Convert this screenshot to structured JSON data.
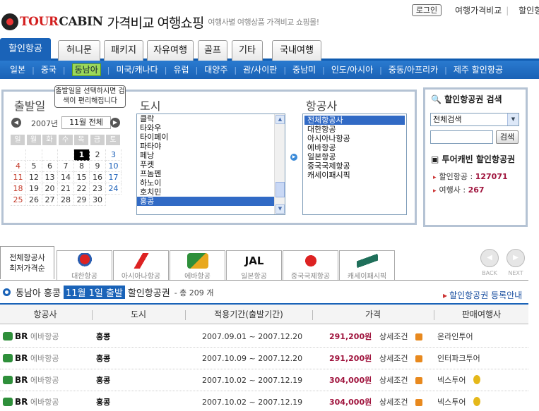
{
  "header": {
    "logo_tour": "TOUR",
    "logo_cabin": "CABIN",
    "logo_main": "가격비교 여행쇼핑",
    "logo_sub": "여행사별 여행상품 가격비교 쇼핑몰!",
    "login": "로그인",
    "top_links": [
      "여행가격비교",
      "할인항공"
    ]
  },
  "tabs": [
    {
      "label": "할인항공",
      "active": true
    },
    {
      "label": "허니문"
    },
    {
      "label": "패키지"
    },
    {
      "label": "자유여행"
    },
    {
      "label": "골프"
    },
    {
      "label": "기타"
    },
    {
      "label": "국내여행"
    }
  ],
  "subnav": [
    "일본",
    "중국",
    "동남아",
    "미국/캐나다",
    "유럽",
    "대양주",
    "괌/사이판",
    "중남미",
    "인도/아시아",
    "중동/아프리카",
    "제주 할인항공"
  ],
  "subnav_selected": "동남아",
  "search": {
    "departure_label": "출발일",
    "tooltip": "출발일을 선택하시면 검색이 편리해집니다",
    "year": "2007년",
    "month": "11월 전체",
    "weekdays": [
      "일",
      "월",
      "화",
      "수",
      "목",
      "금",
      "토"
    ],
    "days": [
      "1",
      "2",
      "3",
      "4",
      "5",
      "6",
      "7",
      "8",
      "9",
      "10",
      "11",
      "12",
      "13",
      "14",
      "15",
      "16",
      "17",
      "18",
      "19",
      "20",
      "21",
      "22",
      "23",
      "24",
      "25",
      "26",
      "27",
      "28",
      "29",
      "30"
    ],
    "today": "1",
    "city_label": "도시",
    "cities": [
      "클락",
      "타와우",
      "타이페이",
      "파타야",
      "페낭",
      "푸켓",
      "프놈펜",
      "하노이",
      "호치민",
      "홍콩"
    ],
    "selected_city": "홍콩",
    "airline_label": "항공사",
    "airlines": [
      "전체항공사",
      "대한항공",
      "아시아나항공",
      "에바항공",
      "일본항공",
      "중국국제항공",
      "캐세이패시픽"
    ],
    "selected_airline": "전체항공사"
  },
  "sidebox": {
    "title": "할인항공권 검색",
    "select_value": "전체검색",
    "search_button": "검색",
    "stats_title": "투어캐빈 할인항공권",
    "stats": [
      {
        "label": "할인항공 :",
        "value": "127071"
      },
      {
        "label": "여행사 :",
        "value": "267"
      }
    ]
  },
  "airline_tabs": {
    "all_line1": "전체항공사",
    "all_line2": "최저가격순",
    "items": [
      "대한항공",
      "아시아나항공",
      "에바항공",
      "일본항공",
      "중국국제항공",
      "캐세이패시픽"
    ],
    "back": "BACK",
    "next": "NEXT"
  },
  "result": {
    "region": "동남아",
    "city": "홍콩",
    "date": "11월 1일 출발",
    "type": "할인항공권",
    "count": "- 총 209 개",
    "register_link": "할인항공권 등록안내"
  },
  "table": {
    "headers": [
      "항공사",
      "도시",
      "적용기간(출발기간)",
      "가격",
      "판매여행사"
    ],
    "rows": [
      {
        "code": "BR",
        "airline": "에바항공",
        "city": "홍콩",
        "period": "2007.09.01 ~ 2007.12.20",
        "price": "291,200원",
        "detail": "상세조건",
        "agency": "온라인투어",
        "medal": false
      },
      {
        "code": "BR",
        "airline": "에바항공",
        "city": "홍콩",
        "period": "2007.10.09 ~ 2007.12.20",
        "price": "291,200원",
        "detail": "상세조건",
        "agency": "인터파크투어",
        "medal": false
      },
      {
        "code": "BR",
        "airline": "에바항공",
        "city": "홍콩",
        "period": "2007.10.02 ~ 2007.12.19",
        "price": "304,000원",
        "detail": "상세조건",
        "agency": "넥스투어",
        "medal": true
      },
      {
        "code": "BR",
        "airline": "에바항공",
        "city": "홍콩",
        "period": "2007.10.02 ~ 2007.12.19",
        "price": "304,000원",
        "detail": "상세조건",
        "agency": "넥스투어",
        "medal": true
      }
    ]
  },
  "colors": {
    "brand_blue": "#1a63b8",
    "price_red": "#a0153e",
    "logo_red": "#d31f1f",
    "highlight_green": "#9bd85a"
  }
}
